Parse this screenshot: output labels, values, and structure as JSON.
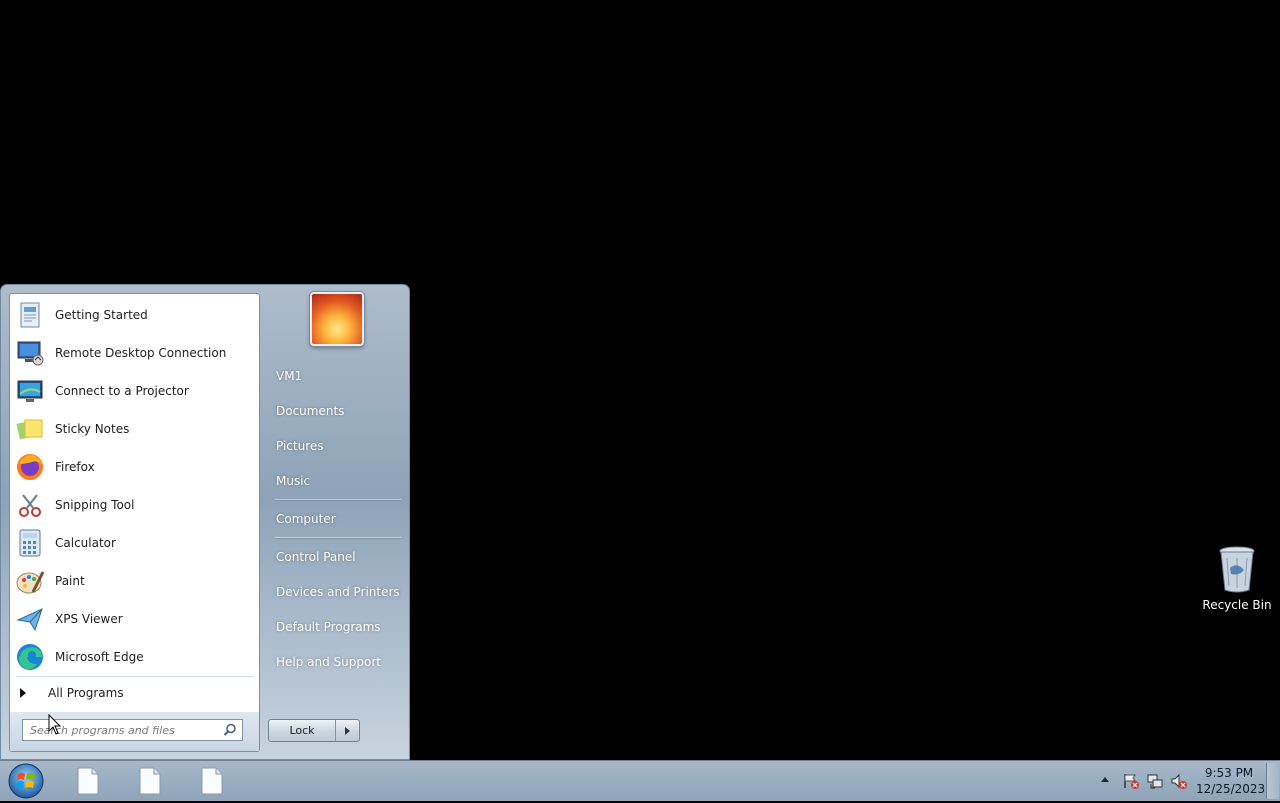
{
  "desktop": {
    "icons": [
      {
        "label": "Recycle Bin",
        "icon": "recycle-bin-icon"
      }
    ]
  },
  "start_menu": {
    "programs": [
      {
        "label": "Getting Started",
        "icon": "getting-started-icon"
      },
      {
        "label": "Remote Desktop Connection",
        "icon": "remote-desktop-icon"
      },
      {
        "label": "Connect to a Projector",
        "icon": "projector-icon"
      },
      {
        "label": "Sticky Notes",
        "icon": "sticky-notes-icon"
      },
      {
        "label": "Firefox",
        "icon": "firefox-icon"
      },
      {
        "label": "Snipping Tool",
        "icon": "snipping-tool-icon"
      },
      {
        "label": "Calculator",
        "icon": "calculator-icon"
      },
      {
        "label": "Paint",
        "icon": "paint-icon"
      },
      {
        "label": "XPS Viewer",
        "icon": "xps-viewer-icon"
      },
      {
        "label": "Microsoft Edge",
        "icon": "edge-icon"
      }
    ],
    "all_programs_label": "All Programs",
    "search_placeholder": "Search programs and files",
    "right_items": {
      "user": "VM1",
      "documents": "Documents",
      "pictures": "Pictures",
      "music": "Music",
      "computer": "Computer",
      "control_panel": "Control Panel",
      "devices_printers": "Devices and Printers",
      "default_programs": "Default Programs",
      "help_support": "Help and Support"
    },
    "lock_label": "Lock"
  },
  "taskbar": {
    "pinned": [
      "file-icon",
      "file-icon",
      "file-icon"
    ],
    "clock_time": "9:53 PM",
    "clock_date": "12/25/2023"
  }
}
